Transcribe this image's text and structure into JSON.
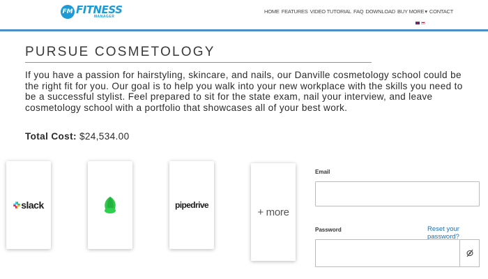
{
  "header": {
    "logo_badge": "FM",
    "logo_main": "FITNESS",
    "logo_sub": "MANAGER",
    "nav": [
      "HOME",
      "FEATURES",
      "VIDEO TUTORIAL",
      "FAQ",
      "DOWNLOAD",
      "BUY MORE",
      "▾",
      "CONTACT"
    ],
    "flags": [
      "uk-flag-icon",
      "language-flag-icon"
    ],
    "accent_color": "#4a8fc8",
    "brand_color": "#1b9ad6"
  },
  "main": {
    "title": "PURSUE COSMETOLOGY",
    "description": "If you have a passion for hairstyling, skincare, and nails, our Danville cosmetology school could be the right fit for you. Our goal is to help you walk into your new workplace with the skills you need to be a successful stylist. Feel prepared to sit for the state exam, nail your interview, and leave cosmetology school with a portfolio that showcases all of your best work.",
    "cost_label": "Total Cost:",
    "cost_value": " $24,534.00"
  },
  "integrations": {
    "slack_label": "slack",
    "green_icon": "green-leaf-icon",
    "pipedrive_label": "pipedrive",
    "more_label": "+ more"
  },
  "login": {
    "email_label": "Email",
    "email_value": "",
    "password_label": "Password",
    "reset_link": "Reset your password?",
    "password_value": "",
    "toggle_icon": "eye-slash-icon",
    "link_color": "#1f6fb2"
  }
}
